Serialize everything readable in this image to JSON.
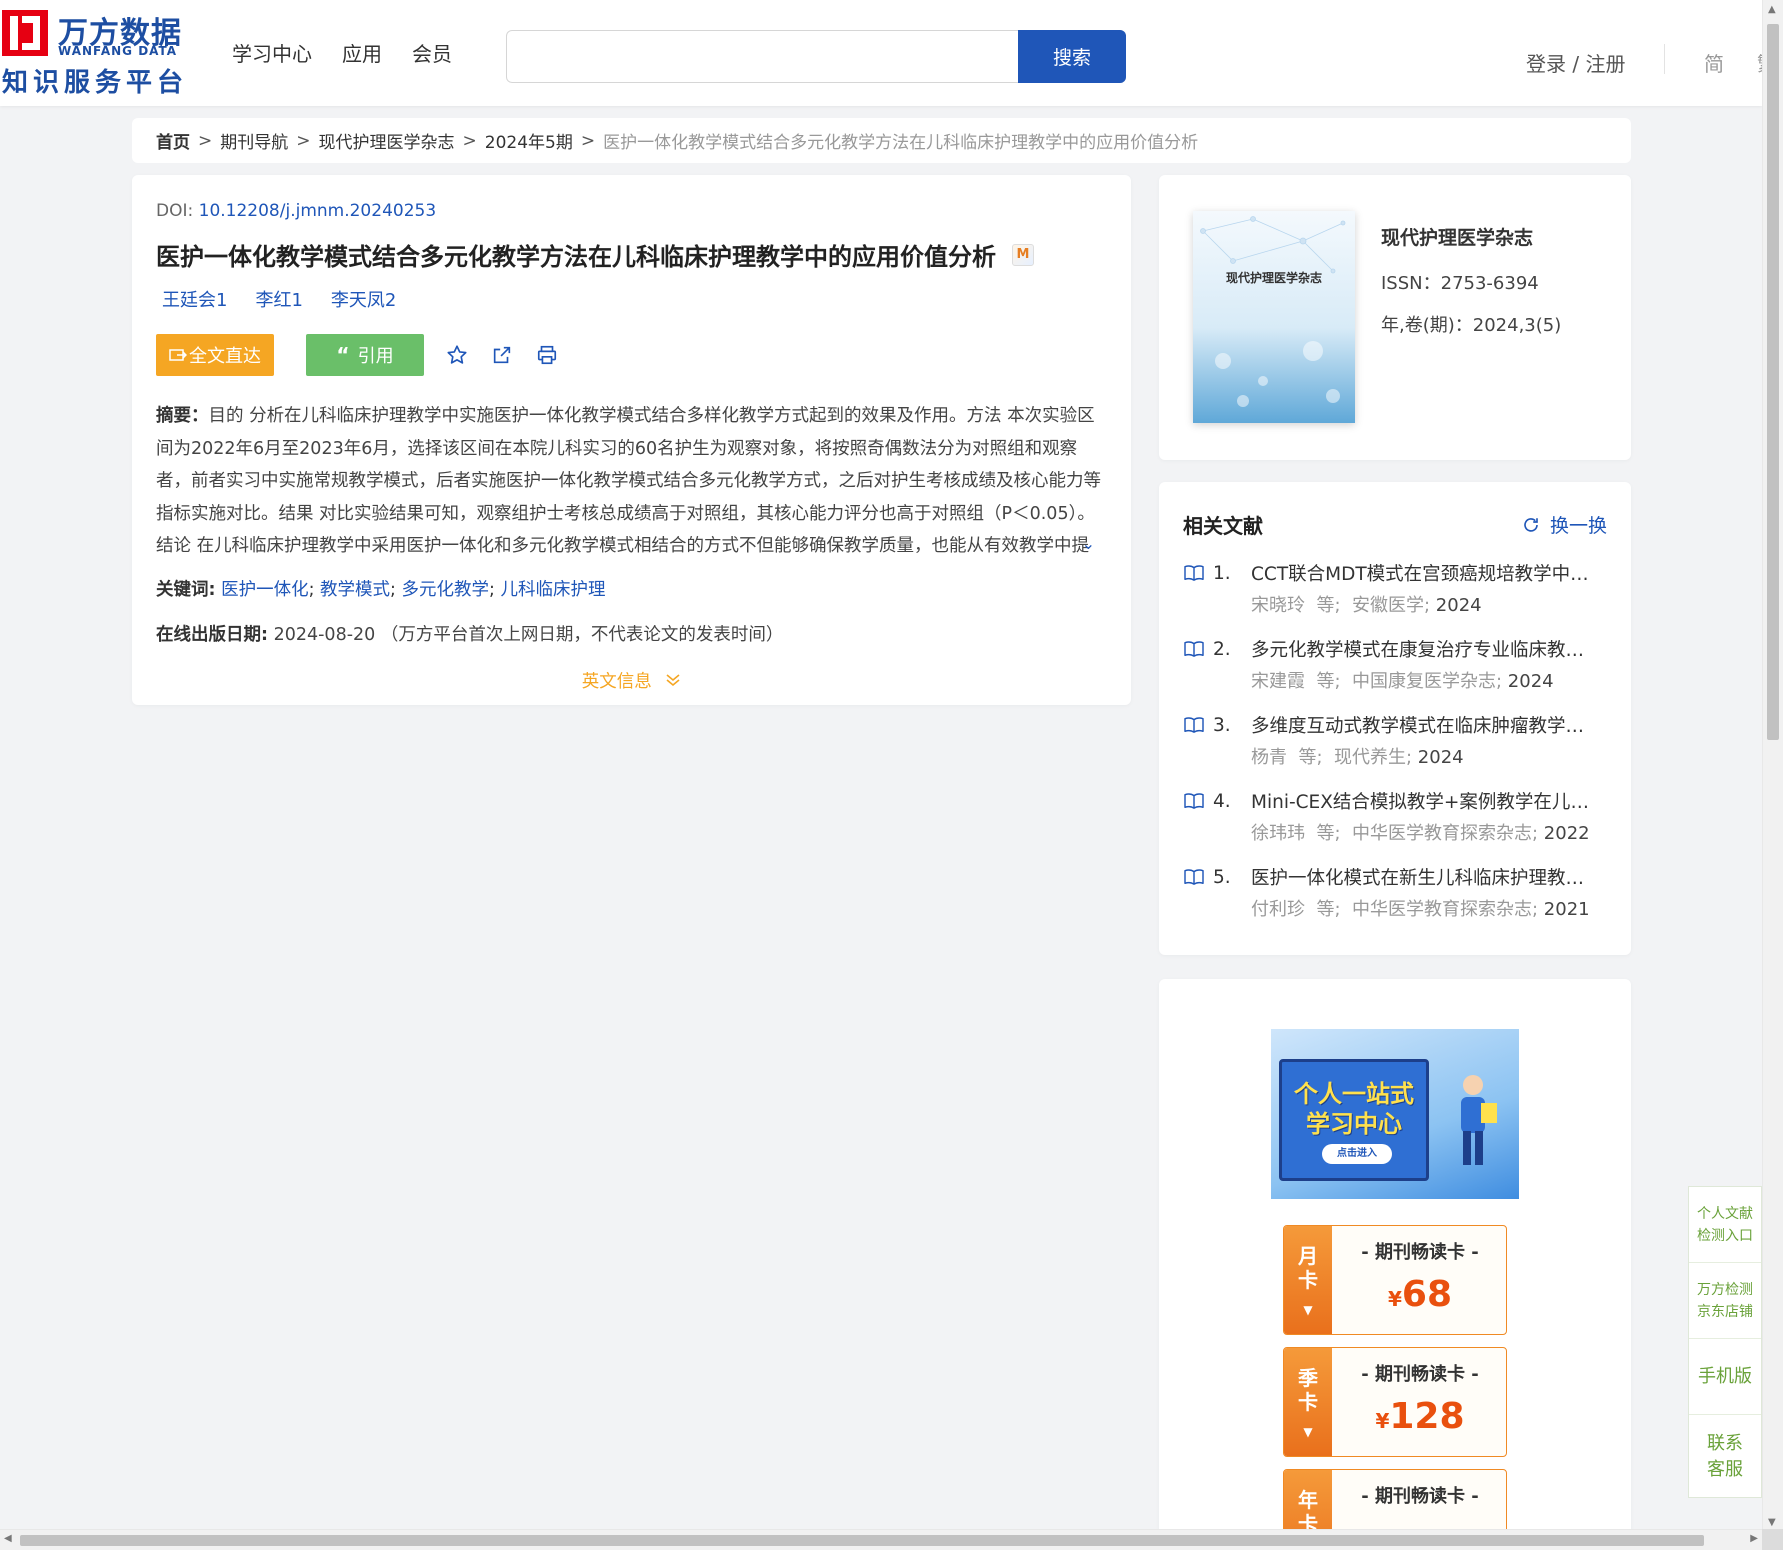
{
  "header": {
    "logo_cn": "万方数据",
    "logo_en": "WANFANG DATA",
    "logo_sub": "知识服务平台",
    "nav": [
      "学习中心",
      "应用",
      "会员"
    ],
    "search_placeholder": "",
    "search_button": "搜索",
    "login": "登录 / 注册",
    "lang_simplified": "简",
    "lang_traditional": "繁"
  },
  "breadcrumb": {
    "home": "首页",
    "items": [
      "期刊导航",
      "现代护理医学杂志",
      "2024年5期"
    ],
    "current": "医护一体化教学模式结合多元化教学方法在儿科临床护理教学中的应用价值分析",
    "separator": ">"
  },
  "article": {
    "doi_label": "DOI: ",
    "doi": "10.12208/j.jmnm.20240253",
    "title": "医护一体化教学模式结合多元化教学方法在儿科临床护理教学中的应用价值分析",
    "title_badge": "M",
    "authors": [
      "王廷会1",
      "李红1",
      "李天凤2"
    ],
    "btn_fulltext": "全文直达",
    "btn_cite": "引用",
    "abstract_label": "摘要：",
    "abstract": "目的 分析在儿科临床护理教学中实施医护一体化教学模式结合多样化教学方式起到的效果及作用。方法 本次实验区间为2022年6月至2023年6月，选择该区间在本院儿科实习的60名护生为观察对象，将按照奇偶数法分为对照组和观察者，前者实习中实施常规教学模式，后者实施医护一体化教学模式结合多元化教学方式，之后对护生考核成绩及核心能力等指标实施对比。结果 对比实验结果可知，观察组护士考核总成绩高于对照组，其核心能力评分也高于对照组（P＜0.05）。结论 在儿科临床护理教学中采用医护一体化和多元化教学模式相结合的方式不但能够确保教学质量，也能从有效教学中提升...",
    "keywords_label": "关键词:",
    "keywords": [
      "医护一体化",
      "教学模式",
      "多元化教学",
      "儿科临床护理"
    ],
    "pubdate_label": "在线出版日期:",
    "pubdate": "2024-08-20",
    "pubdate_note": "（万方平台首次上网日期，不代表论文的发表时间）",
    "en_info": "英文信息"
  },
  "journal": {
    "cover_title": "现代护理医学杂志",
    "name": "现代护理医学杂志",
    "issn": "ISSN：2753-6394",
    "volume": "年,卷(期)：2024,3(5)"
  },
  "related": {
    "title": "相关文献",
    "refresh": "换一换",
    "items": [
      {
        "num": "1.",
        "title": "CCT联合MDT模式在宫颈癌规培教学中的应用价值分析",
        "authors": "宋晓玲",
        "etc": "等;",
        "source": "安徽医学;",
        "year": "2024"
      },
      {
        "num": "2.",
        "title": "多元化教学模式在康复治疗专业临床教学中的应用",
        "authors": "宋建霞",
        "etc": "等;",
        "source": "中国康复医学杂志;",
        "year": "2024"
      },
      {
        "num": "3.",
        "title": "多维度互动式教学模式在临床肿瘤教学中的应用",
        "authors": "杨青",
        "etc": "等;",
        "source": "现代养生;",
        "year": "2024"
      },
      {
        "num": "4.",
        "title": "Mini-CEX结合模拟教学+案例教学在儿科临床教学中的应用",
        "authors": "徐玮玮",
        "etc": "等;",
        "source": "中华医学教育探索杂志;",
        "year": "2022"
      },
      {
        "num": "5.",
        "title": "医护一体化模式在新生儿科临床护理教学中的应用",
        "authors": "付利珍",
        "etc": "等;",
        "source": "中华医学教育探索杂志;",
        "year": "2021"
      }
    ]
  },
  "promo": {
    "banner_line1": "个人一站式",
    "banner_line2": "学习中心",
    "banner_button": "点击进入",
    "cards": [
      {
        "side": [
          "月",
          "卡"
        ],
        "title": "- 期刊畅读卡 -",
        "currency": "¥",
        "price": "68"
      },
      {
        "side": [
          "季",
          "卡"
        ],
        "title": "- 期刊畅读卡 -",
        "currency": "¥",
        "price": "128"
      },
      {
        "side": [
          "年",
          "卡"
        ],
        "title": "- 期刊畅读卡 -",
        "currency": "",
        "price": ""
      }
    ]
  },
  "float_bar": {
    "item1": "个人文献检测入口",
    "item1a": "个人文献",
    "item1b": "检测入口",
    "item2a": "万方检测",
    "item2b": "京东店铺",
    "item3": "手机版",
    "item4a": "联系",
    "item4b": "客服"
  },
  "colors": {
    "brand_blue": "#1f56b8",
    "logo_red": "#e60012",
    "fulltext_orange": "#f5a623",
    "cite_green": "#6abf69",
    "price_red": "#e9500e"
  }
}
